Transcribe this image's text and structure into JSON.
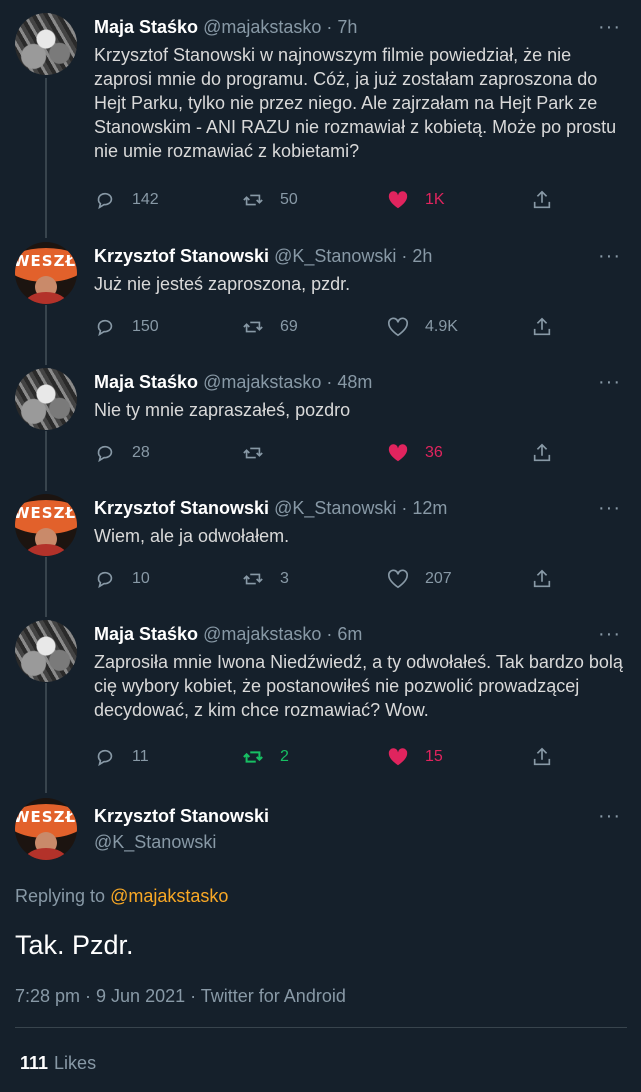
{
  "replies": [
    {
      "author": "Maja Staśko",
      "handle": "@majakstasko",
      "time": "· 7h",
      "text": "Krzysztof Stanowski w najnowszym filmie powiedział, że nie zaprosi mnie do programu. Cóż, ja już zostałam zaproszona do Hejt Parku, tylko nie przez niego. Ale zajrzałam na Hejt Park ze Stanowskim - ANI RAZU nie rozmawiał z kobietą. Może po prostu nie umie rozmawiać z kobietami?",
      "reply_count": "142",
      "retweet_count": "50",
      "like_count": "1K"
    },
    {
      "author": "Krzysztof Stanowski",
      "handle": "@K_Stanowski",
      "time": "· 2h",
      "text": "Już nie jesteś zaproszona, pzdr.",
      "reply_count": "150",
      "retweet_count": "69",
      "like_count": "4.9K"
    },
    {
      "author": "Maja Staśko",
      "handle": "@majakstasko",
      "time": "· 48m",
      "text": "Nie ty mnie zapraszałeś, pozdro",
      "reply_count": "28",
      "retweet_count": "",
      "like_count": "36"
    },
    {
      "author": "Krzysztof Stanowski",
      "handle": "@K_Stanowski",
      "time": "· 12m",
      "text": "Wiem, ale ja odwołałem.",
      "reply_count": "10",
      "retweet_count": "3",
      "like_count": "207"
    },
    {
      "author": "Maja Staśko",
      "handle": "@majakstasko",
      "time": "· 6m",
      "text": "Zaprosiła mnie Iwona Niedźwiedź, a ty odwołałeś. Tak bardzo bolą cię wybory kobiet, że postanowiłeś nie pozwolić prowadzącej decydować, z kim chce rozmawiać? Wow.",
      "reply_count": "11",
      "retweet_count": "2",
      "like_count": "15"
    }
  ],
  "main": {
    "author": "Krzysztof Stanowski",
    "handle": "@K_Stanowski",
    "replying_prefix": "Replying to",
    "replying_handle": "@majakstasko",
    "text": "Tak. Pzdr.",
    "meta": "7:28 pm · 9 Jun 2021 · Twitter for Android",
    "likes_count": "111",
    "likes_label": "Likes"
  },
  "avatar_badge_text": "WESZŁO",
  "more_glyph": "···",
  "colors": {
    "background": "#15202b",
    "text": "#d9d9d9",
    "muted": "#8899a6",
    "like": "#e0245e",
    "retweet": "#17bf63",
    "link": "#f9a825",
    "line": "#38444d"
  },
  "icons": [
    "reply-icon",
    "retweet-icon",
    "heart-icon",
    "share-icon",
    "more-icon"
  ]
}
